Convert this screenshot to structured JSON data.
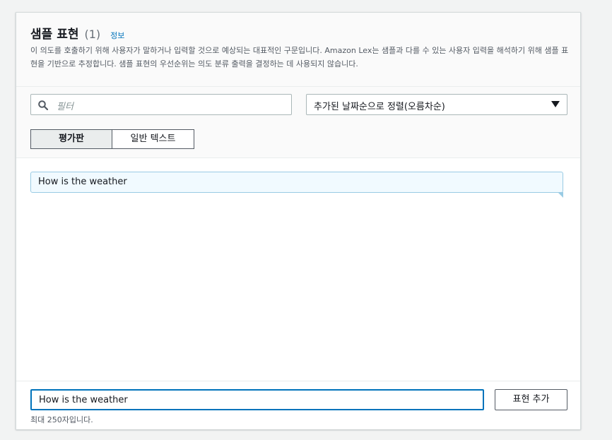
{
  "header": {
    "title": "샘플 표현",
    "count": "(1)",
    "info_link": "정보",
    "description": "이 의도를 호출하기 위해 사용자가 말하거나 입력할 것으로 예상되는 대표적인 구문입니다. Amazon Lex는 샘플과 다를 수 있는 사용자 입력을 해석하기 위해 샘플 표현을 기반으로 추정합니다. 샘플 표현의 우선순위는 의도 분류 출력을 결정하는 데 사용되지 않습니다."
  },
  "toolbar": {
    "search_placeholder": "필터",
    "sort_value": "추가된 날짜순으로 정렬(오름차순)",
    "view_tabs": [
      "평가판",
      "일반 텍스트"
    ],
    "active_tab": "평가판"
  },
  "utterances": [
    {
      "text": "How is the weather"
    }
  ],
  "footer": {
    "input_value": "How is the weather",
    "add_button": "표현 추가",
    "hint": "최대 250자입니다."
  },
  "colors": {
    "accent": "#0073bb",
    "utterance_bg": "#f1faff",
    "utterance_border": "#99cbe4"
  },
  "icons": {
    "search": "search-icon",
    "sort": "caret-down-icon"
  }
}
